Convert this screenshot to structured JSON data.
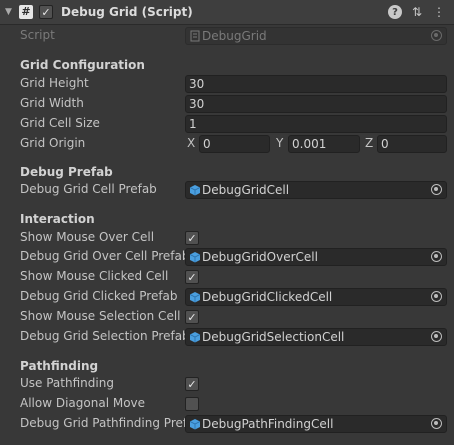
{
  "header": {
    "title": "Debug Grid (Script)",
    "enabled": true,
    "script_icon_glyph": "#",
    "icons": [
      "help-icon",
      "preset-icon",
      "more-icon"
    ]
  },
  "script_row": {
    "label": "Script",
    "value": "DebugGrid"
  },
  "grid_config": {
    "title": "Grid Configuration",
    "height_label": "Grid Height",
    "height_value": "30",
    "width_label": "Grid Width",
    "width_value": "30",
    "cell_size_label": "Grid Cell Size",
    "cell_size_value": "1",
    "origin_label": "Grid Origin",
    "origin": {
      "x_label": "X",
      "x": "0",
      "y_label": "Y",
      "y": "0.001",
      "z_label": "Z",
      "z": "0"
    }
  },
  "debug_prefab": {
    "title": "Debug Prefab",
    "cell_prefab_label": "Debug Grid Cell Prefab",
    "cell_prefab_value": "DebugGridCell"
  },
  "interaction": {
    "title": "Interaction",
    "show_over_label": "Show Mouse Over Cell",
    "show_over": true,
    "over_prefab_label": "Debug Grid Over Cell Prefab",
    "over_prefab_value": "DebugGridOverCell",
    "show_clicked_label": "Show Mouse Clicked Cell",
    "show_clicked": true,
    "clicked_prefab_label": "Debug Grid Clicked Prefab",
    "clicked_prefab_value": "DebugGridClickedCell",
    "show_selection_label": "Show Mouse Selection Cell",
    "show_selection": true,
    "selection_prefab_label": "Debug Grid Selection Prefab",
    "selection_prefab_value": "DebugGridSelectionCell"
  },
  "pathfinding": {
    "title": "Pathfinding",
    "use_label": "Use Pathfinding",
    "use": true,
    "diagonal_label": "Allow Diagonal Move",
    "diagonal": false,
    "prefab_label": "Debug Grid Pathfinding Prefa",
    "prefab_value": "DebugPathFindingCell"
  },
  "colors": {
    "background": "#383838",
    "field": "#2a2a2a",
    "prefab_icon": "#4a9fe0"
  }
}
